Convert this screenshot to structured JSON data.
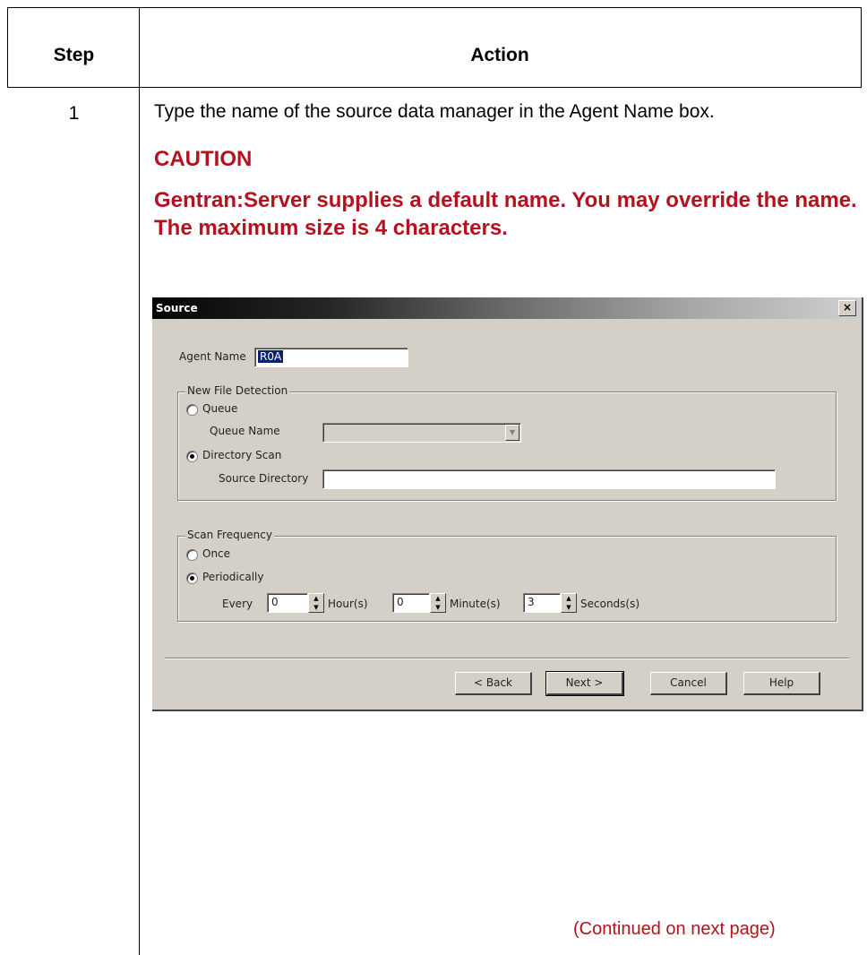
{
  "table": {
    "header": {
      "step": "Step",
      "action": "Action"
    },
    "row": {
      "step": "1",
      "instruction": "Type the name of the source data manager in the Agent Name box.",
      "caution_title": "CAUTION",
      "caution_text": "Gentran:Server supplies a default name. You may override the name. The maximum size is 4 characters."
    },
    "footer": "(Continued on next page)"
  },
  "dialog": {
    "title": "Source",
    "close_label": "×",
    "agent_name_label": "Agent Name",
    "agent_name_value": "R0A",
    "new_file_detection": {
      "title": "New File Detection",
      "queue_label": "Queue",
      "queue_selected": false,
      "queue_name_label": "Queue Name",
      "queue_name_value": "",
      "directory_scan_label": "Directory Scan",
      "directory_scan_selected": true,
      "source_directory_label": "Source Directory",
      "source_directory_value": ""
    },
    "scan_frequency": {
      "title": "Scan Frequency",
      "once_label": "Once",
      "once_selected": false,
      "periodically_label": "Periodically",
      "periodically_selected": true,
      "every_label": "Every",
      "hours_value": "0",
      "hours_label": "Hour(s)",
      "minutes_value": "0",
      "minutes_label": "Minute(s)",
      "seconds_value": "3",
      "seconds_label": "Seconds(s)"
    },
    "buttons": {
      "back": "< Back",
      "next": "Next >",
      "cancel": "Cancel",
      "help": "Help"
    }
  },
  "colors": {
    "caution": "#b3121e",
    "dialog_face": "#d4d0c8",
    "selection": "#0a246a"
  }
}
